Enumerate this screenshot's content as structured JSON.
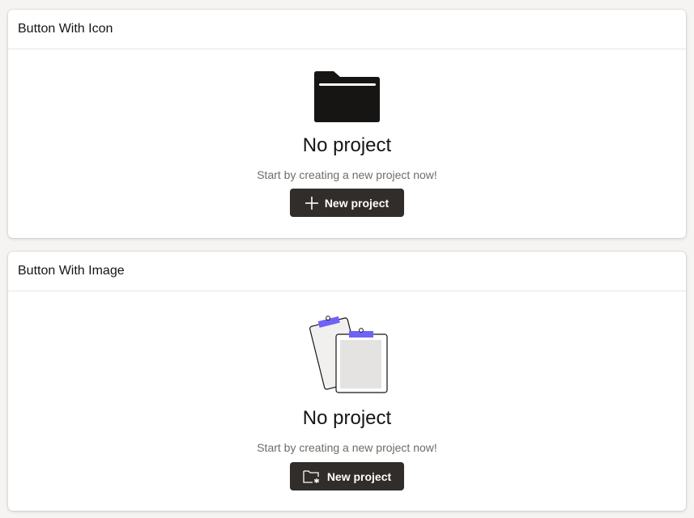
{
  "card_with_icon": {
    "header": "Button With Icon",
    "title": "No project",
    "description": "Start by creating a new project now!",
    "button_label": "New project",
    "illustration_icon": "folder-icon",
    "button_icon": "plus-icon"
  },
  "card_with_image": {
    "header": "Button With Image",
    "title": "No project",
    "description": "Start by creating a new project now!",
    "button_label": "New project",
    "illustration_icon": "clipboards-image",
    "button_icon": "folder-new-icon"
  },
  "colors": {
    "button_bg": "#312d2a",
    "accent_purple": "#6e63f5",
    "page_bg": "#f5f4f2"
  }
}
